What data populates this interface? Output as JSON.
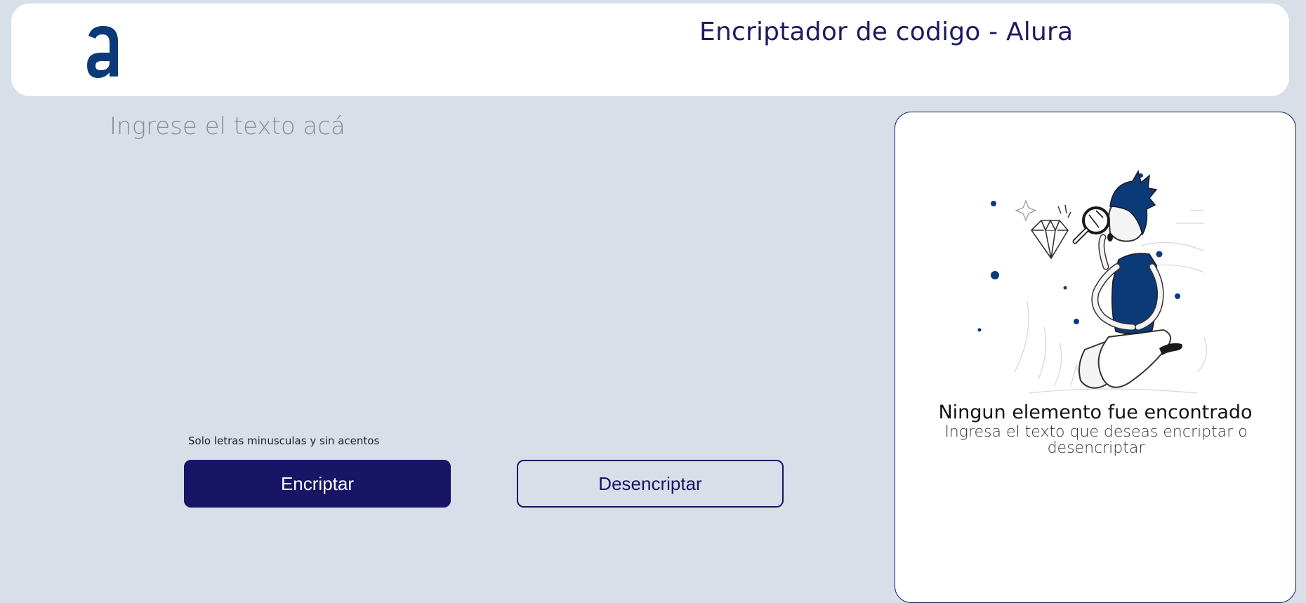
{
  "header": {
    "logo_icon": "alura-logo-icon",
    "title": "Encriptador de codigo - Alura"
  },
  "input": {
    "placeholder": "Ingrese el texto acá",
    "value": ""
  },
  "hint": {
    "text": "Solo letras minusculas y sin acentos"
  },
  "actions": {
    "encrypt_label": "Encriptar",
    "decrypt_label": "Desencriptar"
  },
  "output": {
    "illustration_icon": "person-with-magnifying-glass-icon",
    "empty_title": "Ningun elemento fue encontrado",
    "empty_subtitle": "Ingresa el texto que deseas encriptar o desencriptar"
  },
  "colors": {
    "background": "#d8dfe9",
    "primary": "#181466",
    "accent_blue": "#0b3a78",
    "surface": "#ffffff"
  }
}
